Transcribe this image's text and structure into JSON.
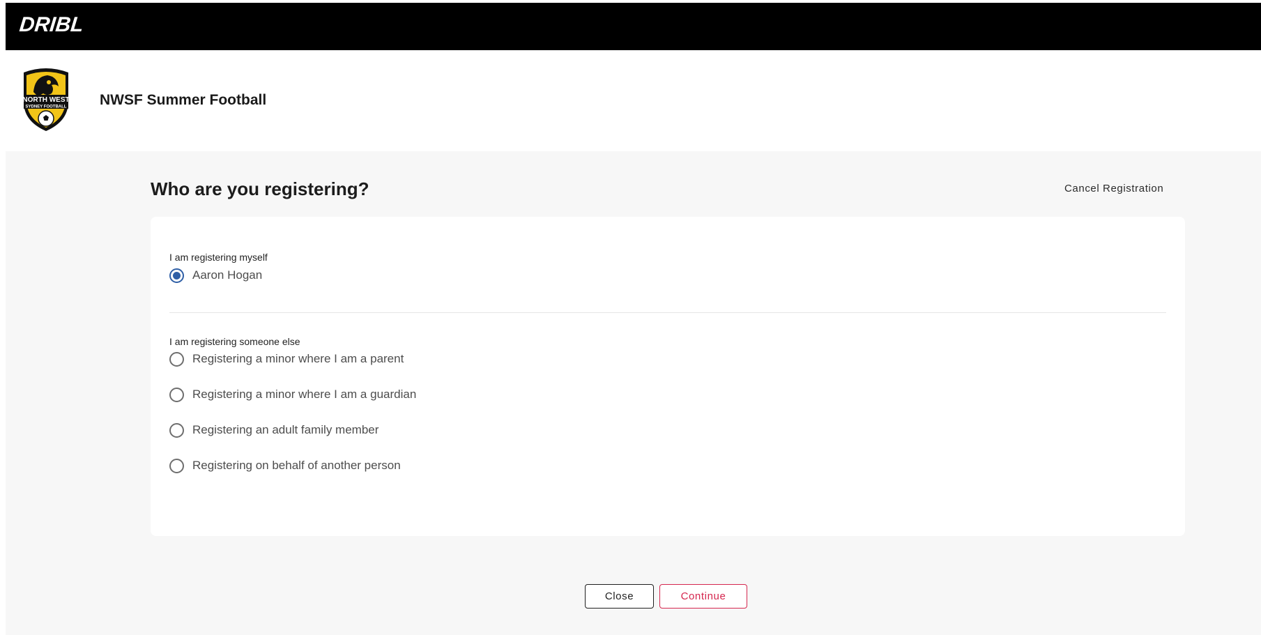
{
  "app": {
    "brand": "DRIBL"
  },
  "organization": {
    "name": "NWSF Summer Football",
    "logo_text_line1": "NORTH WEST",
    "logo_text_line2": "SYDNEY FOOTBALL",
    "logo_colors": {
      "shield": "#111111",
      "yellow": "#f2c418"
    }
  },
  "page": {
    "title": "Who are you registering?",
    "cancel_label": "Cancel Registration"
  },
  "form": {
    "self_section_label": "I am registering myself",
    "self_option": {
      "label": "Aaron Hogan",
      "checked": true
    },
    "other_section_label": "I am registering someone else",
    "other_options": [
      {
        "label": "Registering a minor where I am a parent",
        "checked": false
      },
      {
        "label": "Registering a minor where I am a guardian",
        "checked": false
      },
      {
        "label": "Registering an adult family member",
        "checked": false
      },
      {
        "label": "Registering on behalf of another person",
        "checked": false
      }
    ]
  },
  "actions": {
    "close_label": "Close",
    "continue_label": "Continue"
  },
  "colors": {
    "topbar": "#000000",
    "radio_selected": "#2f5fa6",
    "continue_accent": "#d5264e",
    "content_bg": "#f7f7f7"
  }
}
